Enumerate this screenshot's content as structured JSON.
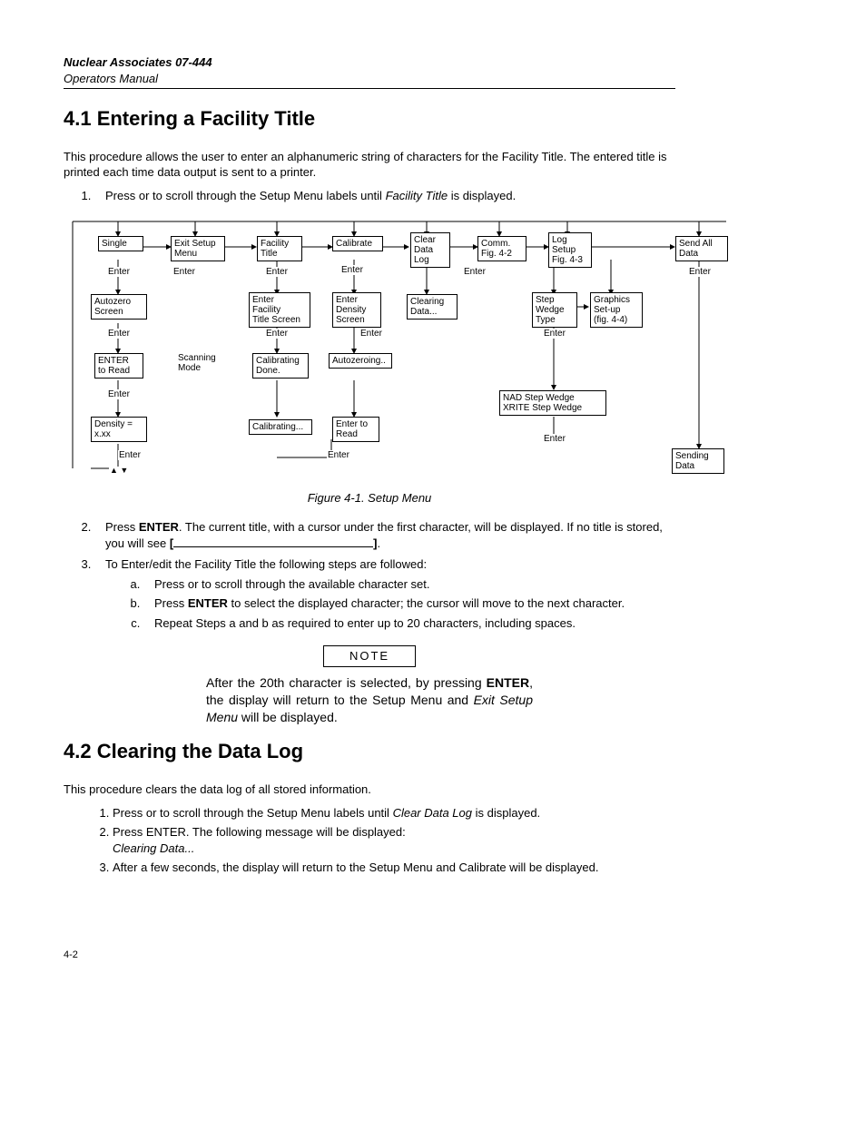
{
  "header": {
    "title": "Nuclear Associates 07-444",
    "subtitle": "Operators Manual"
  },
  "section41": {
    "heading": "4.1 Entering a Facility Title",
    "intro": "This procedure allows the user to enter an alphanumeric string of characters for the Facility Title.  The entered title is printed each time data output is sent to a printer.",
    "step1_pre": "Press   or   to scroll through the Setup Menu labels until ",
    "step1_em": "Facility Title",
    "step1_post": " is displayed.",
    "fig_caption": "Figure 4-1. Setup Menu",
    "step2_pre": "Press ",
    "step2_enter": "ENTER",
    "step2_mid": ".  The current title, with a cursor under the first character, will be displayed.  If no title is stored, you will see ",
    "step2_br1": "[",
    "step2_br2": "]",
    "step2_end": ".",
    "step3": "To Enter/edit the Facility Title the following steps are followed:",
    "step3a": "Press   or   to scroll through the available character set.",
    "step3b_pre": "Press ",
    "step3b_enter": "ENTER",
    "step3b_post": " to select the displayed character; the cursor will move to the next character.",
    "step3c": "Repeat Steps a and b as required to enter up to 20 characters, including spaces.",
    "note_label": "NOTE",
    "note_pre": "After the 20th character is selected, by pressing ",
    "note_enter": "ENTER",
    "note_mid": ", the display will return to the Setup Menu and ",
    "note_em": "Exit Setup Menu",
    "note_post": " will be displayed."
  },
  "section42": {
    "heading": "4.2 Clearing the Data Log",
    "intro": "This procedure clears the data log of all stored information.",
    "step1_pre": "Press   or   to scroll through the Setup Menu labels until ",
    "step1_em": "Clear Data Log",
    "step1_post": " is displayed.",
    "step2": "Press ENTER.  The following message will be displayed:",
    "step2_msg": "Clearing Data...",
    "step3": "After a few seconds, the display will return to the Setup Menu and Calibrate will be displayed."
  },
  "boxes": {
    "single": "Single",
    "exit": "Exit Setup\nMenu",
    "facility": "Facility\nTitle",
    "calibrate": "Calibrate",
    "clear": "Clear\nData\nLog",
    "comm": "Comm.\nFig. 4-2",
    "log": "Log\nSetup\nFig. 4-3",
    "sendall": "Send All\nData",
    "autozero": "Autozero\nScreen",
    "efts": "Enter\nFacility\nTitle Screen",
    "eds": "Enter\nDensity\nScreen",
    "clearing": "Clearing\nData...",
    "step": "Step\nWedge\nType",
    "graphics": "Graphics\nSet-up\n(fig. 4-4)",
    "enterread": "ENTER\nto Read",
    "scanning": "Scanning\nMode",
    "caldone": "Calibrating\nDone.",
    "autozeroing": "Autozeroing..",
    "nadxr": "NAD Step Wedge\nXRITE Step Wedge",
    "density": "Density =\nx.xx",
    "calibrating": "Calibrating...",
    "etr2": "Enter to\nRead",
    "sending": "Sending\nData"
  },
  "labels": {
    "enter": "Enter"
  },
  "page": "4-2"
}
